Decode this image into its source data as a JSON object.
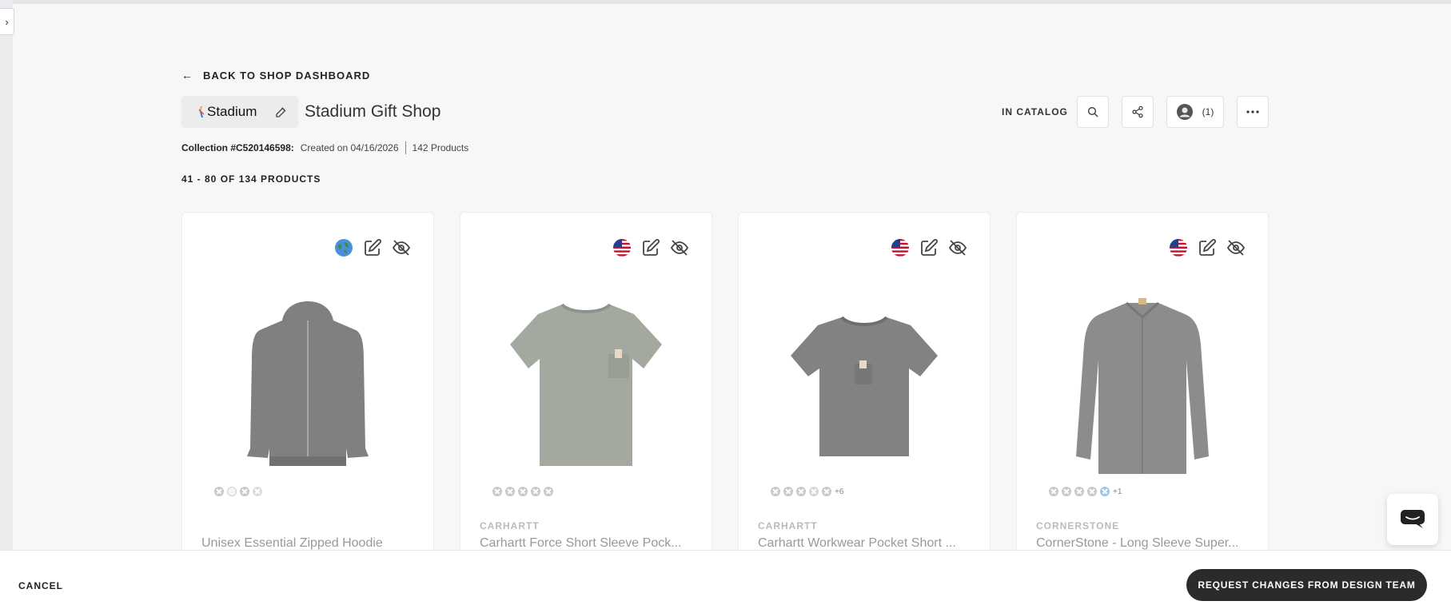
{
  "nav": {
    "back_label": "BACK TO SHOP DASHBOARD"
  },
  "shop": {
    "logo_text": "Stadium",
    "title": "Stadium Gift Shop",
    "status": "IN CATALOG",
    "users_count": "(1)"
  },
  "collection": {
    "id_label": "Collection #C520146598:",
    "created": "Created on 04/16/2026",
    "product_count": "142 Products"
  },
  "range_label": "41 - 80 OF 134 PRODUCTS",
  "products": [
    {
      "brand": "",
      "name": "Unisex Essential Zipped Hoodie",
      "region_icon": "globe-icon",
      "extra_colors": "",
      "garment": "hoodie",
      "color": "#808080"
    },
    {
      "brand": "CARHARTT",
      "name": "Carhartt Force Short Sleeve Pock...",
      "region_icon": "us-flag-icon",
      "extra_colors": "",
      "garment": "tshirt",
      "color": "#a4a9a0"
    },
    {
      "brand": "CARHARTT",
      "name": "Carhartt Workwear Pocket Short ...",
      "region_icon": "us-flag-icon",
      "extra_colors": "+6",
      "garment": "tshirt",
      "color": "#828282"
    },
    {
      "brand": "CORNERSTONE",
      "name": "CornerStone - Long Sleeve Super...",
      "region_icon": "us-flag-icon",
      "extra_colors": "+1",
      "garment": "shirt",
      "color": "#8c8c8c"
    }
  ],
  "footer": {
    "cancel_label": "CANCEL",
    "request_label": "REQUEST CHANGES FROM DESIGN TEAM"
  },
  "colors": {
    "accent_dark": "#2b2b2b",
    "background": "#f7f7f7"
  }
}
